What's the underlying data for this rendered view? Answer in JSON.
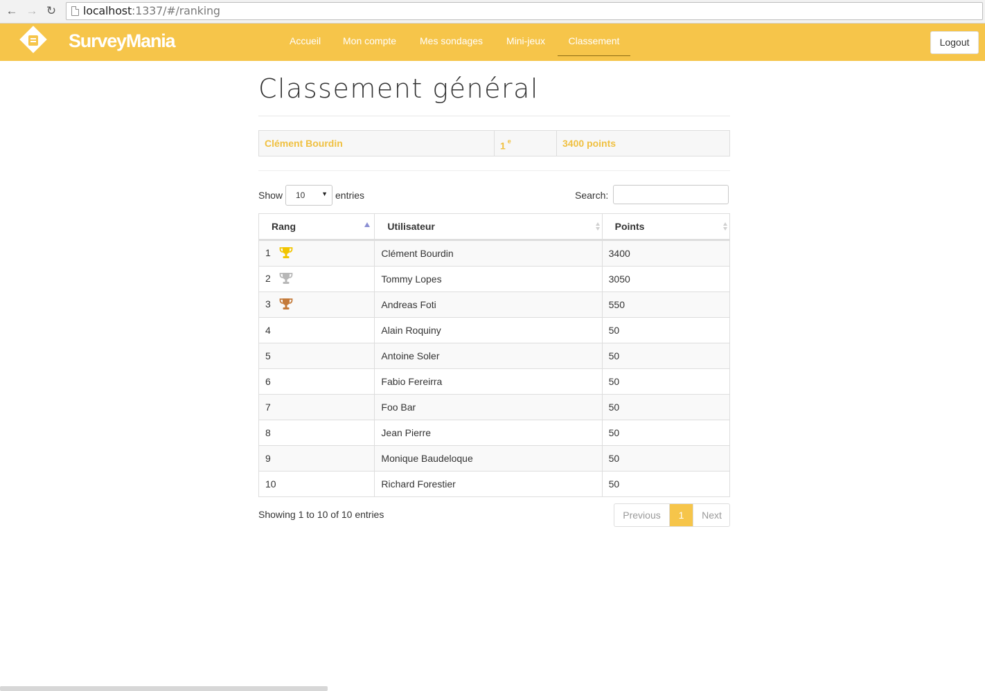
{
  "browser": {
    "url_host": "localhost",
    "url_rest": ":1337/#/ranking"
  },
  "navbar": {
    "brand": "SurveyMania",
    "items": [
      {
        "label": "Accueil"
      },
      {
        "label": "Mon compte"
      },
      {
        "label": "Mes sondages"
      },
      {
        "label": "Mini-jeux"
      },
      {
        "label": "Classement",
        "active": true
      }
    ],
    "logout_label": "Logout",
    "bg_color": "#f6c54a"
  },
  "page": {
    "title": "Classement général"
  },
  "my_rank": {
    "name": "Clément Bourdin",
    "rank": "1",
    "rank_suffix": "e",
    "points": "3400 points",
    "text_color": "#f0c040"
  },
  "table_controls": {
    "show_label": "Show",
    "length_value": "10",
    "entries_label": "entries",
    "search_label": "Search:",
    "search_value": ""
  },
  "table": {
    "columns": [
      "Rang",
      "Utilisateur",
      "Points"
    ],
    "rows": [
      {
        "rank": "1",
        "user": "Clément Bourdin",
        "points": "3400",
        "trophy": "gold-trophy-icon"
      },
      {
        "rank": "2",
        "user": "Tommy Lopes",
        "points": "3050",
        "trophy": "silver-trophy-icon"
      },
      {
        "rank": "3",
        "user": "Andreas Foti",
        "points": "550",
        "trophy": "bronze-trophy-icon"
      },
      {
        "rank": "4",
        "user": "Alain Roquiny",
        "points": "50"
      },
      {
        "rank": "5",
        "user": "Antoine Soler",
        "points": "50"
      },
      {
        "rank": "6",
        "user": "Fabio Fereirra",
        "points": "50"
      },
      {
        "rank": "7",
        "user": "Foo Bar",
        "points": "50"
      },
      {
        "rank": "8",
        "user": "Jean Pierre",
        "points": "50"
      },
      {
        "rank": "9",
        "user": "Monique Baudeloque",
        "points": "50"
      },
      {
        "rank": "10",
        "user": "Richard Forestier",
        "points": "50"
      }
    ],
    "trophy_colors": {
      "gold-trophy-icon": "#f2c500",
      "silver-trophy-icon": "#b7b7b7",
      "bronze-trophy-icon": "#c47a3a"
    }
  },
  "footer": {
    "info": "Showing 1 to 10 of 10 entries",
    "previous_label": "Previous",
    "current_page": "1",
    "next_label": "Next"
  }
}
